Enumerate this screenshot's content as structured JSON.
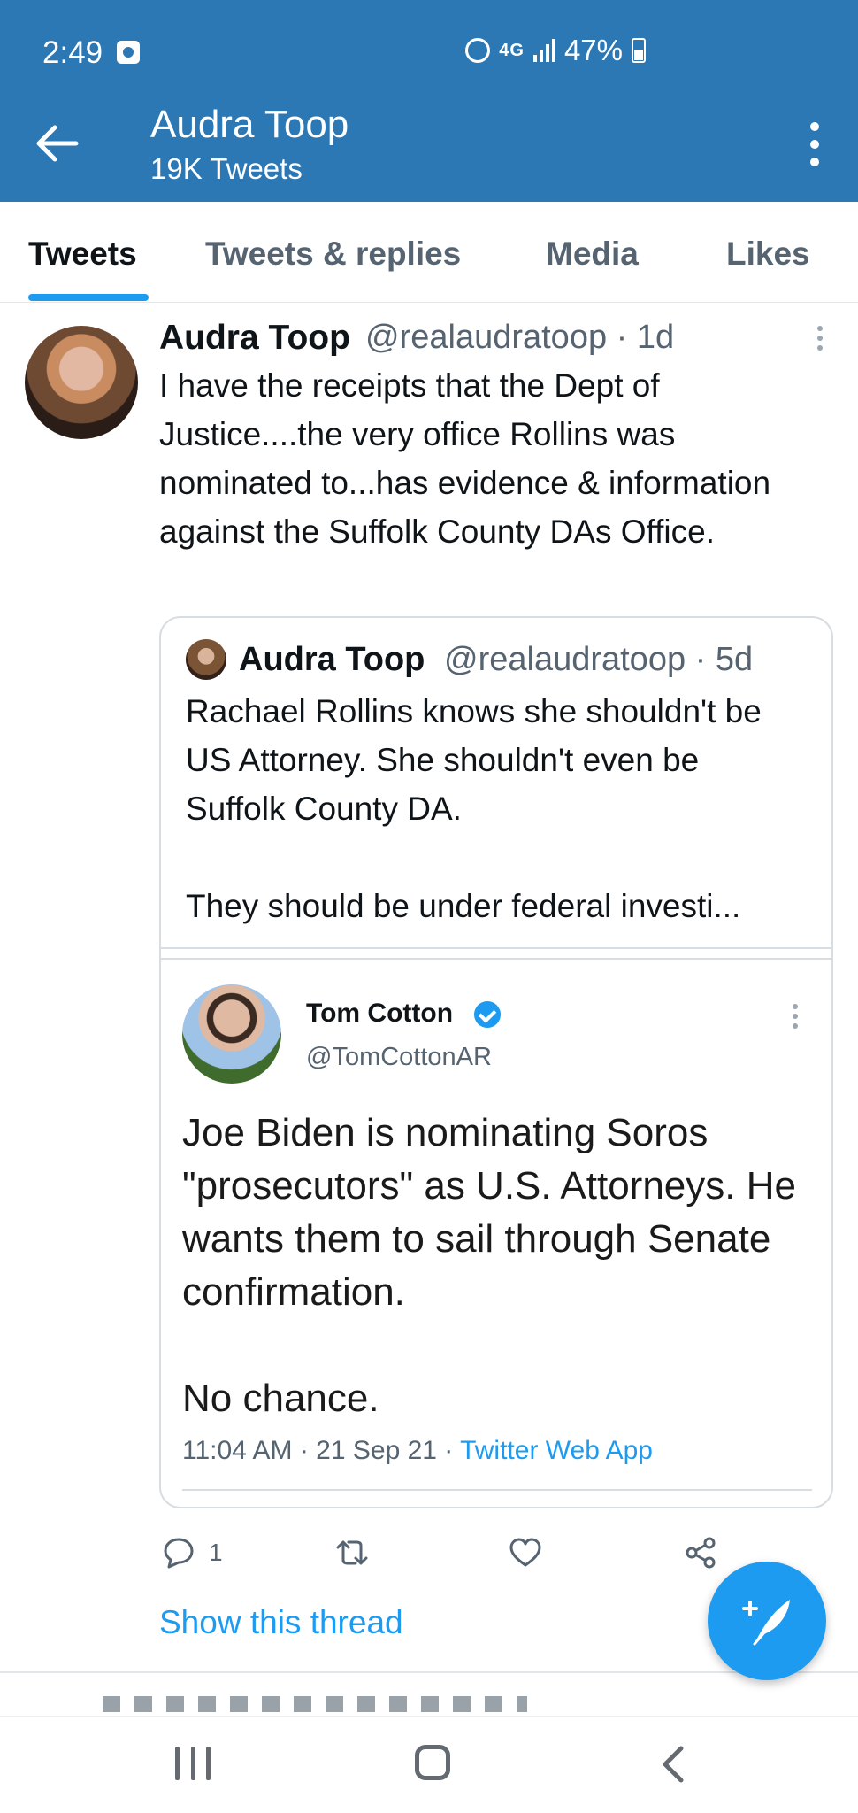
{
  "status_bar": {
    "time": "2:49",
    "network": "4G",
    "battery": "47%"
  },
  "header": {
    "title": "Audra Toop",
    "subtitle": "19K Tweets"
  },
  "tabs": [
    {
      "label": "Tweets",
      "active": true
    },
    {
      "label": "Tweets & replies",
      "active": false
    },
    {
      "label": "Media",
      "active": false
    },
    {
      "label": "Likes",
      "active": false
    }
  ],
  "tweet": {
    "author_name": "Audra Toop",
    "author_handle_time": "@realaudratoop · 1d",
    "text": "I have the receipts that the Dept of Justice....the very office Rollins was nominated to...has evidence & information against the Suffolk County DAs Office.",
    "quote": {
      "author_name": "Audra Toop",
      "author_handle_time": "@realaudratoop · 5d",
      "text_line1": "Rachael Rollins knows she shouldn't be US Attorney. She shouldn't even be Suffolk County DA.",
      "text_line2": "They should be under federal investi...",
      "embedded": {
        "name": "Tom Cotton",
        "handle": "@TomCottonAR",
        "text_line1": "Joe Biden is nominating Soros \"prosecutors\" as U.S. Attorneys. He wants them to sail through Senate confirmation.",
        "text_line2": "No chance.",
        "timestamp": "11:04 AM · 21 Sep 21 · ",
        "source_app": "Twitter Web App"
      }
    },
    "actions": {
      "reply_count": "1"
    },
    "show_thread_label": "Show this thread"
  },
  "colors": {
    "header_bg": "#2b78b5",
    "accent": "#1d9bf0",
    "text_secondary": "#566370"
  },
  "icons": {
    "back": "arrow-left-icon",
    "more": "more-vertical-icon",
    "reply": "comment-icon",
    "retweet": "retweet-icon",
    "like": "heart-icon",
    "share": "share-icon",
    "compose": "feather-plus-icon"
  }
}
